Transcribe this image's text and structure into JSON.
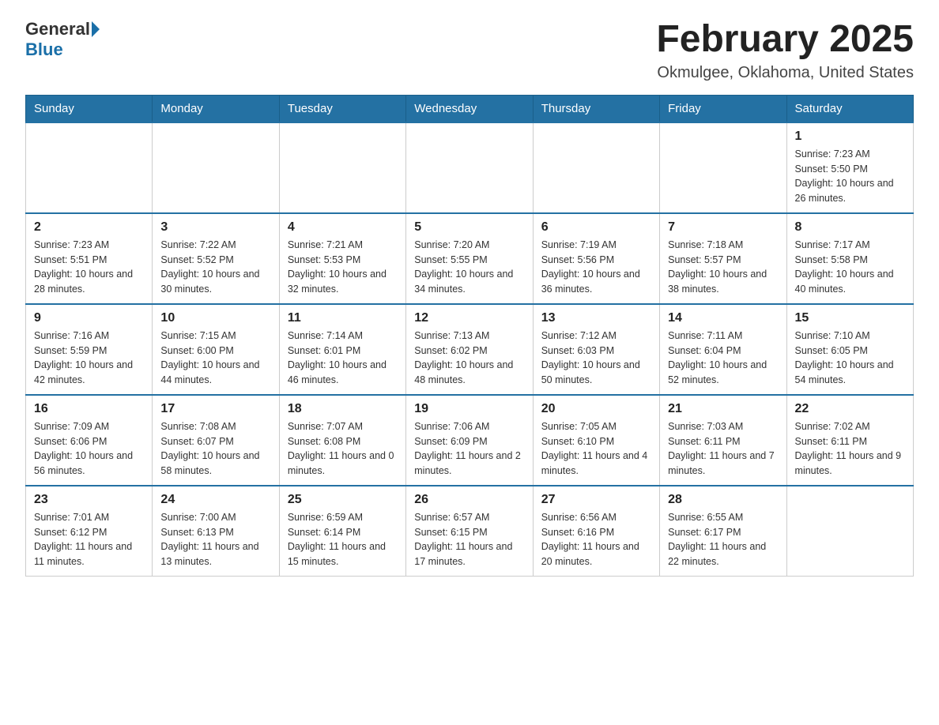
{
  "header": {
    "logo_general": "General",
    "logo_blue": "Blue",
    "month_title": "February 2025",
    "location": "Okmulgee, Oklahoma, United States"
  },
  "days_of_week": [
    "Sunday",
    "Monday",
    "Tuesday",
    "Wednesday",
    "Thursday",
    "Friday",
    "Saturday"
  ],
  "weeks": [
    [
      {
        "day": "",
        "info": ""
      },
      {
        "day": "",
        "info": ""
      },
      {
        "day": "",
        "info": ""
      },
      {
        "day": "",
        "info": ""
      },
      {
        "day": "",
        "info": ""
      },
      {
        "day": "",
        "info": ""
      },
      {
        "day": "1",
        "info": "Sunrise: 7:23 AM\nSunset: 5:50 PM\nDaylight: 10 hours and 26 minutes."
      }
    ],
    [
      {
        "day": "2",
        "info": "Sunrise: 7:23 AM\nSunset: 5:51 PM\nDaylight: 10 hours and 28 minutes."
      },
      {
        "day": "3",
        "info": "Sunrise: 7:22 AM\nSunset: 5:52 PM\nDaylight: 10 hours and 30 minutes."
      },
      {
        "day": "4",
        "info": "Sunrise: 7:21 AM\nSunset: 5:53 PM\nDaylight: 10 hours and 32 minutes."
      },
      {
        "day": "5",
        "info": "Sunrise: 7:20 AM\nSunset: 5:55 PM\nDaylight: 10 hours and 34 minutes."
      },
      {
        "day": "6",
        "info": "Sunrise: 7:19 AM\nSunset: 5:56 PM\nDaylight: 10 hours and 36 minutes."
      },
      {
        "day": "7",
        "info": "Sunrise: 7:18 AM\nSunset: 5:57 PM\nDaylight: 10 hours and 38 minutes."
      },
      {
        "day": "8",
        "info": "Sunrise: 7:17 AM\nSunset: 5:58 PM\nDaylight: 10 hours and 40 minutes."
      }
    ],
    [
      {
        "day": "9",
        "info": "Sunrise: 7:16 AM\nSunset: 5:59 PM\nDaylight: 10 hours and 42 minutes."
      },
      {
        "day": "10",
        "info": "Sunrise: 7:15 AM\nSunset: 6:00 PM\nDaylight: 10 hours and 44 minutes."
      },
      {
        "day": "11",
        "info": "Sunrise: 7:14 AM\nSunset: 6:01 PM\nDaylight: 10 hours and 46 minutes."
      },
      {
        "day": "12",
        "info": "Sunrise: 7:13 AM\nSunset: 6:02 PM\nDaylight: 10 hours and 48 minutes."
      },
      {
        "day": "13",
        "info": "Sunrise: 7:12 AM\nSunset: 6:03 PM\nDaylight: 10 hours and 50 minutes."
      },
      {
        "day": "14",
        "info": "Sunrise: 7:11 AM\nSunset: 6:04 PM\nDaylight: 10 hours and 52 minutes."
      },
      {
        "day": "15",
        "info": "Sunrise: 7:10 AM\nSunset: 6:05 PM\nDaylight: 10 hours and 54 minutes."
      }
    ],
    [
      {
        "day": "16",
        "info": "Sunrise: 7:09 AM\nSunset: 6:06 PM\nDaylight: 10 hours and 56 minutes."
      },
      {
        "day": "17",
        "info": "Sunrise: 7:08 AM\nSunset: 6:07 PM\nDaylight: 10 hours and 58 minutes."
      },
      {
        "day": "18",
        "info": "Sunrise: 7:07 AM\nSunset: 6:08 PM\nDaylight: 11 hours and 0 minutes."
      },
      {
        "day": "19",
        "info": "Sunrise: 7:06 AM\nSunset: 6:09 PM\nDaylight: 11 hours and 2 minutes."
      },
      {
        "day": "20",
        "info": "Sunrise: 7:05 AM\nSunset: 6:10 PM\nDaylight: 11 hours and 4 minutes."
      },
      {
        "day": "21",
        "info": "Sunrise: 7:03 AM\nSunset: 6:11 PM\nDaylight: 11 hours and 7 minutes."
      },
      {
        "day": "22",
        "info": "Sunrise: 7:02 AM\nSunset: 6:11 PM\nDaylight: 11 hours and 9 minutes."
      }
    ],
    [
      {
        "day": "23",
        "info": "Sunrise: 7:01 AM\nSunset: 6:12 PM\nDaylight: 11 hours and 11 minutes."
      },
      {
        "day": "24",
        "info": "Sunrise: 7:00 AM\nSunset: 6:13 PM\nDaylight: 11 hours and 13 minutes."
      },
      {
        "day": "25",
        "info": "Sunrise: 6:59 AM\nSunset: 6:14 PM\nDaylight: 11 hours and 15 minutes."
      },
      {
        "day": "26",
        "info": "Sunrise: 6:57 AM\nSunset: 6:15 PM\nDaylight: 11 hours and 17 minutes."
      },
      {
        "day": "27",
        "info": "Sunrise: 6:56 AM\nSunset: 6:16 PM\nDaylight: 11 hours and 20 minutes."
      },
      {
        "day": "28",
        "info": "Sunrise: 6:55 AM\nSunset: 6:17 PM\nDaylight: 11 hours and 22 minutes."
      },
      {
        "day": "",
        "info": ""
      }
    ]
  ]
}
